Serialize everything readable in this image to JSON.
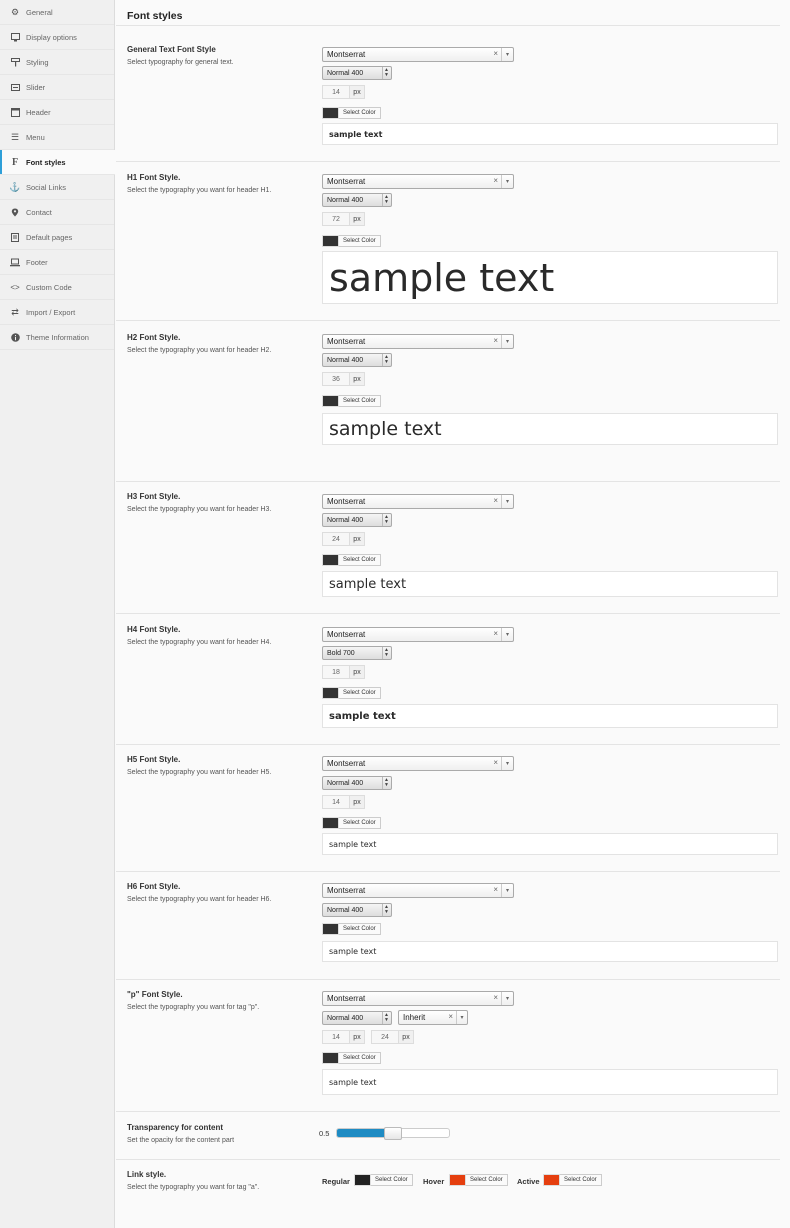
{
  "sidebar": {
    "items": [
      {
        "label": "General",
        "icon": "gear-icon"
      },
      {
        "label": "Display options",
        "icon": "display-icon"
      },
      {
        "label": "Styling",
        "icon": "brush-icon"
      },
      {
        "label": "Slider",
        "icon": "slider-icon"
      },
      {
        "label": "Header",
        "icon": "window-icon"
      },
      {
        "label": "Menu",
        "icon": "menu-icon"
      },
      {
        "label": "Font styles",
        "icon": "font-icon"
      },
      {
        "label": "Social Links",
        "icon": "anchor-icon"
      },
      {
        "label": "Contact",
        "icon": "location-pin-icon"
      },
      {
        "label": "Default pages",
        "icon": "document-icon"
      },
      {
        "label": "Footer",
        "icon": "laptop-icon"
      },
      {
        "label": "Custom Code",
        "icon": "code-icon"
      },
      {
        "label": "Import / Export",
        "icon": "transfer-icon"
      },
      {
        "label": "Theme Information",
        "icon": "info-icon"
      }
    ],
    "active_index": 6
  },
  "page_title": "Font styles",
  "sections": {
    "general": {
      "title": "General Text Font Style",
      "desc": "Select typography for general text.",
      "font": "Montserrat",
      "weight": "Normal 400",
      "size": "14",
      "unit": "px",
      "color_label": "Select Color",
      "preview": "sample text"
    },
    "h1": {
      "title": "H1 Font Style.",
      "desc": "Select the typography you want for header H1.",
      "font": "Montserrat",
      "weight": "Normal 400",
      "size": "72",
      "unit": "px",
      "color_label": "Select Color",
      "preview": "sample text"
    },
    "h2": {
      "title": "H2 Font Style.",
      "desc": "Select the typography you want for header H2.",
      "font": "Montserrat",
      "weight": "Normal 400",
      "size": "36",
      "unit": "px",
      "color_label": "Select Color",
      "preview": "sample text"
    },
    "h3": {
      "title": "H3 Font Style.",
      "desc": "Select the typography you want for header H3.",
      "font": "Montserrat",
      "weight": "Normal 400",
      "size": "24",
      "unit": "px",
      "color_label": "Select Color",
      "preview": "sample text"
    },
    "h4": {
      "title": "H4 Font Style.",
      "desc": "Select the typography you want for header H4.",
      "font": "Montserrat",
      "weight": "Bold 700",
      "size": "18",
      "unit": "px",
      "color_label": "Select Color",
      "preview": "sample text"
    },
    "h5": {
      "title": "H5 Font Style.",
      "desc": "Select the typography you want for header H5.",
      "font": "Montserrat",
      "weight": "Normal 400",
      "size": "14",
      "unit": "px",
      "color_label": "Select Color",
      "preview": "sample text"
    },
    "h6": {
      "title": "H6 Font Style.",
      "desc": "Select the typography you want for header H6.",
      "font": "Montserrat",
      "weight": "Normal 400",
      "color_label": "Select Color",
      "preview": "sample text"
    },
    "p": {
      "title": "\"p\" Font Style.",
      "desc": "Select the typography you want for tag \"p\".",
      "font": "Montserrat",
      "weight": "Normal 400",
      "inherit": "Inherit",
      "size": "14",
      "line_height": "24",
      "unit": "px",
      "color_label": "Select Color",
      "preview": "sample text"
    }
  },
  "transparency": {
    "title": "Transparency for content",
    "desc": "Set the opacity for the content part",
    "value": "0.5",
    "level": 0.5
  },
  "link_style": {
    "title": "Link style.",
    "desc": "Select the typography you want for tag \"a\".",
    "regular_label": "Regular",
    "hover_label": "Hover",
    "active_label": "Active",
    "color_label": "Select Color",
    "regular_color": "#222222",
    "hover_color": "#e53f0f",
    "active_color": "#e53f0f"
  },
  "icons": {
    "clear": "×",
    "dropdown": "▾",
    "updown_up": "▲",
    "updown_down": "▼"
  },
  "colors": {
    "accent": "#1e8bc3",
    "swatch": "#333333"
  }
}
